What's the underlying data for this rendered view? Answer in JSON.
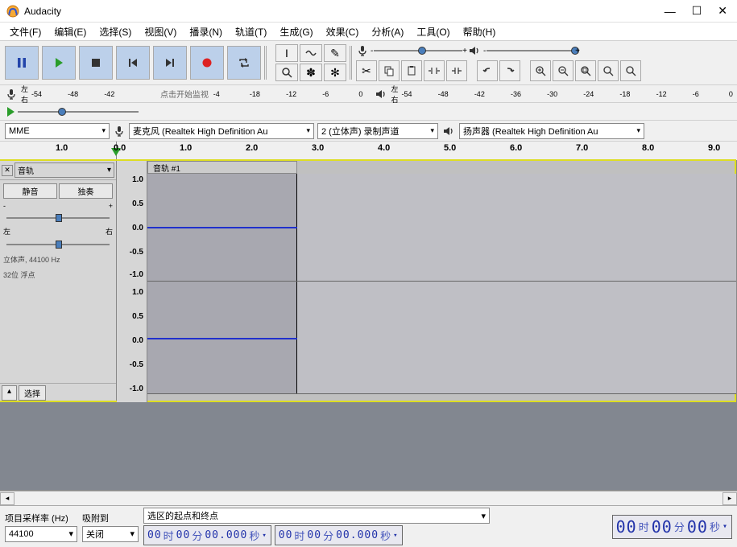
{
  "title": "Audacity",
  "menu": {
    "file": "文件(F)",
    "edit": "编辑(E)",
    "select": "选择(S)",
    "view": "视图(V)",
    "transport": "播录(N)",
    "tracks": "轨道(T)",
    "generate": "生成(G)",
    "effect": "效果(C)",
    "analyze": "分析(A)",
    "tools": "工具(O)",
    "help": "帮助(H)"
  },
  "meters": {
    "lr_label_l": "左",
    "lr_label_r": "右",
    "ticks": [
      "-54",
      "-48",
      "-42",
      "-36",
      "-30",
      "-24",
      "-18",
      "-12",
      "-6",
      "0"
    ],
    "click_msg": "点击开始监视"
  },
  "devices": {
    "host": "MME",
    "input": "麦克风 (Realtek High Definition Au",
    "channels": "2 (立体声) 录制声道",
    "output": "扬声器 (Realtek High Definition Au"
  },
  "timeline": {
    "ticks": [
      "1.0",
      "0.0",
      "1.0",
      "2.0",
      "3.0",
      "4.0",
      "5.0",
      "6.0",
      "7.0",
      "8.0",
      "9.0"
    ]
  },
  "track": {
    "menu_name": "音轨",
    "clip_name": "音轨 #1",
    "mute": "静音",
    "solo": "独奏",
    "pan_l": "左",
    "pan_r": "右",
    "info1": "立体声, 44100 Hz",
    "info2": "32位 浮点",
    "select_btn": "选择",
    "y_ticks": [
      "1.0",
      "0.5",
      "0.0",
      "-0.5",
      "-1.0",
      "1.0",
      "0.5",
      "0.0",
      "-0.5",
      "-1.0"
    ],
    "gain_minus": "-",
    "gain_plus": "+"
  },
  "status": {
    "rate_label": "项目采样率 (Hz)",
    "rate_value": "44100",
    "snap_label": "吸附到",
    "snap_value": "关闭",
    "selection_label": "选区的起点和终点",
    "time1_h": "00",
    "time1_hl": "时",
    "time1_m": "00",
    "time1_ml": "分",
    "time1_s": "00.000",
    "time1_sl": "秒",
    "time2_h": "00",
    "time2_hl": "时",
    "time2_m": "00",
    "time2_ml": "分",
    "time2_s": "00.000",
    "time2_sl": "秒",
    "bigtime_h": "00",
    "bigtime_hl": "时",
    "bigtime_m": "00",
    "bigtime_ml": "分",
    "bigtime_s": "00",
    "bigtime_sl": "秒"
  }
}
